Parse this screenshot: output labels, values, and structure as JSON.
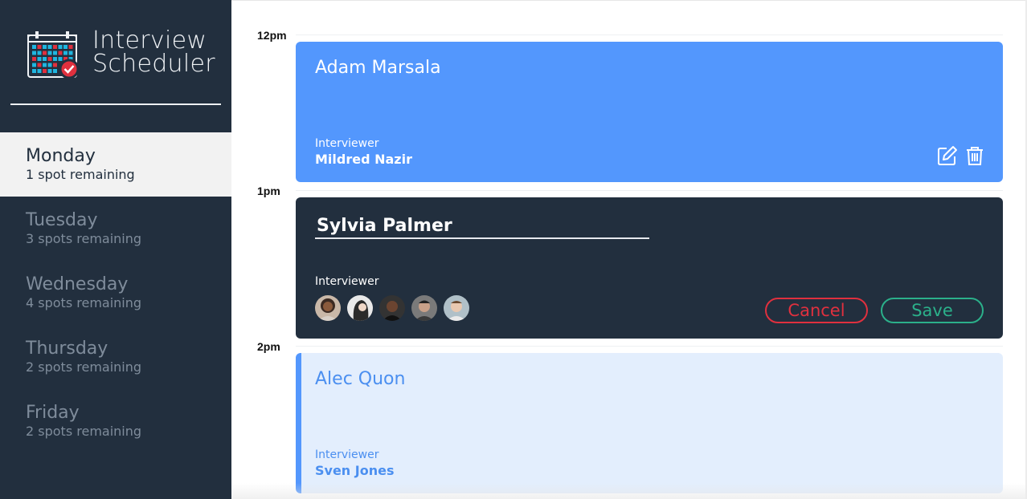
{
  "app": {
    "title_line1": "Interview",
    "title_line2": "Scheduler",
    "logo_icon": "calendar-check-icon"
  },
  "days": [
    {
      "name": "Monday",
      "spots": "1 spot remaining",
      "selected": true
    },
    {
      "name": "Tuesday",
      "spots": "3 spots remaining",
      "selected": false
    },
    {
      "name": "Wednesday",
      "spots": "4 spots remaining",
      "selected": false
    },
    {
      "name": "Thursday",
      "spots": "2 spots remaining",
      "selected": false
    },
    {
      "name": "Friday",
      "spots": "2 spots remaining",
      "selected": false
    }
  ],
  "times": [
    "12pm",
    "1pm",
    "2pm"
  ],
  "appointments": {
    "booked": {
      "student": "Adam Marsala",
      "interviewer_caption": "Interviewer",
      "interviewer": "Mildred Nazir",
      "edit_icon": "edit-icon",
      "delete_icon": "trash-icon"
    },
    "form": {
      "student_value": "Sylvia Palmer",
      "interviewer_caption": "Interviewer",
      "avatars": [
        "avatar-1",
        "avatar-2",
        "avatar-3",
        "avatar-4",
        "avatar-5"
      ],
      "cancel_label": "Cancel",
      "save_label": "Save"
    },
    "pending": {
      "student": "Alec Quon",
      "interviewer_caption": "Interviewer",
      "interviewer": "Sven Jones"
    }
  },
  "colors": {
    "sidebar": "#222f3e",
    "booked": "#5397fd",
    "pending_bg": "#e3eefd",
    "cancel": "#e0303e",
    "save": "#2bb08a"
  }
}
